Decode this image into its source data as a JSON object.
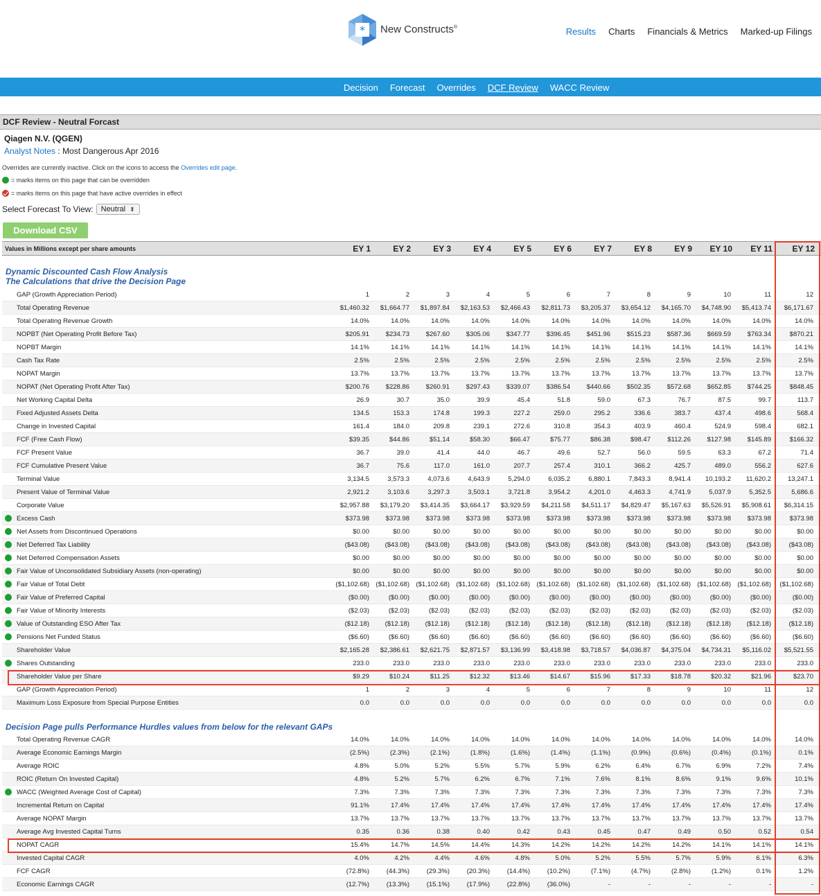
{
  "brand": {
    "name": "New Constructs",
    "mark": "®"
  },
  "topnav": [
    {
      "label": "Results",
      "active": true
    },
    {
      "label": "Charts",
      "active": false
    },
    {
      "label": "Financials & Metrics",
      "active": false
    },
    {
      "label": "Marked-up Filings",
      "active": false
    }
  ],
  "subnav": [
    {
      "label": "Decision",
      "active": false
    },
    {
      "label": "Forecast",
      "active": false
    },
    {
      "label": "Overrides",
      "active": false
    },
    {
      "label": "DCF Review",
      "active": true
    },
    {
      "label": "WACC Review",
      "active": false
    }
  ],
  "page_title": "DCF Review - Neutral Forcast",
  "company": "Qiagen N.V. (QGEN)",
  "analyst": {
    "link": "Analyst Notes",
    "sep": " : ",
    "text": "Most Dangerous Apr 2016"
  },
  "notes": {
    "overrides_pre": "Overrides are currently inactive. Click on the icons to access the ",
    "overrides_link": "Overrides edit page",
    "overrides_post": ".",
    "legend_green": "= marks items on this page that can be overridden",
    "legend_red": "= marks items on this page that have active overrides in effect"
  },
  "forecast_select": {
    "label": "Select Forecast To View:",
    "value": "Neutral",
    "arrows": "⬍"
  },
  "download_button": "Download CSV",
  "table": {
    "units_label": "Values in Millions except per share amounts",
    "columns": [
      "EY 1",
      "EY 2",
      "EY 3",
      "EY 4",
      "EY 5",
      "EY 6",
      "EY 7",
      "EY 8",
      "EY 9",
      "EY 10",
      "EY 11",
      "EY 12"
    ],
    "section1_line1": "Dynamic Discounted Cash Flow Analysis",
    "section1_line2": "The Calculations that drive the Decision Page",
    "section2": "Decision Page pulls Performance Hurdles values from below for the relevant GAPs",
    "rows1": [
      {
        "label": "GAP (Growth Appreciation Period)",
        "dot": false,
        "v": [
          "1",
          "2",
          "3",
          "4",
          "5",
          "6",
          "7",
          "8",
          "9",
          "10",
          "11",
          "12"
        ]
      },
      {
        "label": "Total Operating Revenue",
        "dot": false,
        "v": [
          "$1,460.32",
          "$1,664.77",
          "$1,897.84",
          "$2,163.53",
          "$2,466.43",
          "$2,811.73",
          "$3,205.37",
          "$3,654.12",
          "$4,165.70",
          "$4,748.90",
          "$5,413.74",
          "$6,171.67"
        ]
      },
      {
        "label": "Total Operating Revenue Growth",
        "dot": false,
        "v": [
          "14.0%",
          "14.0%",
          "14.0%",
          "14.0%",
          "14.0%",
          "14.0%",
          "14.0%",
          "14.0%",
          "14.0%",
          "14.0%",
          "14.0%",
          "14.0%"
        ]
      },
      {
        "label": "NOPBT (Net Operating Profit Before Tax)",
        "dot": false,
        "v": [
          "$205.91",
          "$234.73",
          "$267.60",
          "$305.06",
          "$347.77",
          "$396.45",
          "$451.96",
          "$515.23",
          "$587.36",
          "$669.59",
          "$763.34",
          "$870.21"
        ]
      },
      {
        "label": "NOPBT Margin",
        "dot": false,
        "v": [
          "14.1%",
          "14.1%",
          "14.1%",
          "14.1%",
          "14.1%",
          "14.1%",
          "14.1%",
          "14.1%",
          "14.1%",
          "14.1%",
          "14.1%",
          "14.1%"
        ]
      },
      {
        "label": "Cash Tax Rate",
        "dot": false,
        "v": [
          "2.5%",
          "2.5%",
          "2.5%",
          "2.5%",
          "2.5%",
          "2.5%",
          "2.5%",
          "2.5%",
          "2.5%",
          "2.5%",
          "2.5%",
          "2.5%"
        ]
      },
      {
        "label": "NOPAT Margin",
        "dot": false,
        "v": [
          "13.7%",
          "13.7%",
          "13.7%",
          "13.7%",
          "13.7%",
          "13.7%",
          "13.7%",
          "13.7%",
          "13.7%",
          "13.7%",
          "13.7%",
          "13.7%"
        ]
      },
      {
        "label": "NOPAT (Net Operating Profit After Tax)",
        "dot": false,
        "v": [
          "$200.76",
          "$228.86",
          "$260.91",
          "$297.43",
          "$339.07",
          "$386.54",
          "$440.66",
          "$502.35",
          "$572.68",
          "$652.85",
          "$744.25",
          "$848.45"
        ]
      },
      {
        "label": "Net Working Capital Delta",
        "dot": false,
        "v": [
          "26.9",
          "30.7",
          "35.0",
          "39.9",
          "45.4",
          "51.8",
          "59.0",
          "67.3",
          "76.7",
          "87.5",
          "99.7",
          "113.7"
        ]
      },
      {
        "label": "Fixed Adjusted Assets Delta",
        "dot": false,
        "v": [
          "134.5",
          "153.3",
          "174.8",
          "199.3",
          "227.2",
          "259.0",
          "295.2",
          "336.6",
          "383.7",
          "437.4",
          "498.6",
          "568.4"
        ]
      },
      {
        "label": "Change in Invested Capital",
        "dot": false,
        "v": [
          "161.4",
          "184.0",
          "209.8",
          "239.1",
          "272.6",
          "310.8",
          "354.3",
          "403.9",
          "460.4",
          "524.9",
          "598.4",
          "682.1"
        ]
      },
      {
        "label": "FCF (Free Cash Flow)",
        "dot": false,
        "v": [
          "$39.35",
          "$44.86",
          "$51.14",
          "$58.30",
          "$66.47",
          "$75.77",
          "$86.38",
          "$98.47",
          "$112.26",
          "$127.98",
          "$145.89",
          "$166.32"
        ]
      },
      {
        "label": "FCF Present Value",
        "dot": false,
        "v": [
          "36.7",
          "39.0",
          "41.4",
          "44.0",
          "46.7",
          "49.6",
          "52.7",
          "56.0",
          "59.5",
          "63.3",
          "67.2",
          "71.4"
        ]
      },
      {
        "label": "FCF Cumulative Present Value",
        "dot": false,
        "v": [
          "36.7",
          "75.6",
          "117.0",
          "161.0",
          "207.7",
          "257.4",
          "310.1",
          "366.2",
          "425.7",
          "489.0",
          "556.2",
          "627.6"
        ]
      },
      {
        "label": "Terminal Value",
        "dot": false,
        "v": [
          "3,134.5",
          "3,573.3",
          "4,073.6",
          "4,643.9",
          "5,294.0",
          "6,035.2",
          "6,880.1",
          "7,843.3",
          "8,941.4",
          "10,193.2",
          "11,620.2",
          "13,247.1"
        ]
      },
      {
        "label": "Present Value of Terminal Value",
        "dot": false,
        "v": [
          "2,921.2",
          "3,103.6",
          "3,297.3",
          "3,503.1",
          "3,721.8",
          "3,954.2",
          "4,201.0",
          "4,463.3",
          "4,741.9",
          "5,037.9",
          "5,352.5",
          "5,686.6"
        ]
      },
      {
        "label": "Corporate Value",
        "dot": false,
        "v": [
          "$2,957.88",
          "$3,179.20",
          "$3,414.35",
          "$3,664.17",
          "$3,929.59",
          "$4,211.58",
          "$4,511.17",
          "$4,829.47",
          "$5,167.63",
          "$5,526.91",
          "$5,908.61",
          "$6,314.15"
        ]
      },
      {
        "label": "Excess Cash",
        "dot": true,
        "v": [
          "$373.98",
          "$373.98",
          "$373.98",
          "$373.98",
          "$373.98",
          "$373.98",
          "$373.98",
          "$373.98",
          "$373.98",
          "$373.98",
          "$373.98",
          "$373.98"
        ]
      },
      {
        "label": "Net Assets from Discontinued Operations",
        "dot": true,
        "v": [
          "$0.00",
          "$0.00",
          "$0.00",
          "$0.00",
          "$0.00",
          "$0.00",
          "$0.00",
          "$0.00",
          "$0.00",
          "$0.00",
          "$0.00",
          "$0.00"
        ]
      },
      {
        "label": "Net Deferred Tax Liability",
        "dot": true,
        "v": [
          "($43.08)",
          "($43.08)",
          "($43.08)",
          "($43.08)",
          "($43.08)",
          "($43.08)",
          "($43.08)",
          "($43.08)",
          "($43.08)",
          "($43.08)",
          "($43.08)",
          "($43.08)"
        ]
      },
      {
        "label": "Net Deferred Compensation Assets",
        "dot": true,
        "v": [
          "$0.00",
          "$0.00",
          "$0.00",
          "$0.00",
          "$0.00",
          "$0.00",
          "$0.00",
          "$0.00",
          "$0.00",
          "$0.00",
          "$0.00",
          "$0.00"
        ]
      },
      {
        "label": "Fair Value of Unconsolidated Subsidiary Assets (non-operating)",
        "dot": true,
        "v": [
          "$0.00",
          "$0.00",
          "$0.00",
          "$0.00",
          "$0.00",
          "$0.00",
          "$0.00",
          "$0.00",
          "$0.00",
          "$0.00",
          "$0.00",
          "$0.00"
        ]
      },
      {
        "label": "Fair Value of Total Debt",
        "dot": true,
        "v": [
          "($1,102.68)",
          "($1,102.68)",
          "($1,102.68)",
          "($1,102.68)",
          "($1,102.68)",
          "($1,102.68)",
          "($1,102.68)",
          "($1,102.68)",
          "($1,102.68)",
          "($1,102.68)",
          "($1,102.68)",
          "($1,102.68)"
        ]
      },
      {
        "label": "Fair Value of Preferred Capital",
        "dot": true,
        "v": [
          "($0.00)",
          "($0.00)",
          "($0.00)",
          "($0.00)",
          "($0.00)",
          "($0.00)",
          "($0.00)",
          "($0.00)",
          "($0.00)",
          "($0.00)",
          "($0.00)",
          "($0.00)"
        ]
      },
      {
        "label": "Fair Value of Minority Interests",
        "dot": true,
        "v": [
          "($2.03)",
          "($2.03)",
          "($2.03)",
          "($2.03)",
          "($2.03)",
          "($2.03)",
          "($2.03)",
          "($2.03)",
          "($2.03)",
          "($2.03)",
          "($2.03)",
          "($2.03)"
        ]
      },
      {
        "label": "Value of Outstanding ESO After Tax",
        "dot": true,
        "v": [
          "($12.18)",
          "($12.18)",
          "($12.18)",
          "($12.18)",
          "($12.18)",
          "($12.18)",
          "($12.18)",
          "($12.18)",
          "($12.18)",
          "($12.18)",
          "($12.18)",
          "($12.18)"
        ]
      },
      {
        "label": "Pensions Net Funded Status",
        "dot": true,
        "v": [
          "($6.60)",
          "($6.60)",
          "($6.60)",
          "($6.60)",
          "($6.60)",
          "($6.60)",
          "($6.60)",
          "($6.60)",
          "($6.60)",
          "($6.60)",
          "($6.60)",
          "($6.60)"
        ]
      },
      {
        "label": "Shareholder Value",
        "dot": false,
        "v": [
          "$2,165.28",
          "$2,386.61",
          "$2,621.75",
          "$2,871.57",
          "$3,136.99",
          "$3,418.98",
          "$3,718.57",
          "$4,036.87",
          "$4,375.04",
          "$4,734.31",
          "$5,116.02",
          "$5,521.55"
        ]
      },
      {
        "label": "Shares Outstanding",
        "dot": true,
        "v": [
          "233.0",
          "233.0",
          "233.0",
          "233.0",
          "233.0",
          "233.0",
          "233.0",
          "233.0",
          "233.0",
          "233.0",
          "233.0",
          "233.0"
        ]
      },
      {
        "label": "Shareholder Value per Share",
        "dot": false,
        "v": [
          "$9.29",
          "$10.24",
          "$11.25",
          "$12.32",
          "$13.46",
          "$14.67",
          "$15.96",
          "$17.33",
          "$18.78",
          "$20.32",
          "$21.96",
          "$23.70"
        ]
      },
      {
        "label": "GAP (Growth Appreciation Period)",
        "dot": false,
        "v": [
          "1",
          "2",
          "3",
          "4",
          "5",
          "6",
          "7",
          "8",
          "9",
          "10",
          "11",
          "12"
        ]
      },
      {
        "label": "Maximum Loss Exposure from Special Purpose Entities",
        "dot": false,
        "v": [
          "0.0",
          "0.0",
          "0.0",
          "0.0",
          "0.0",
          "0.0",
          "0.0",
          "0.0",
          "0.0",
          "0.0",
          "0.0",
          "0.0"
        ]
      }
    ],
    "rows2": [
      {
        "label": "Total Operating Revenue CAGR",
        "dot": false,
        "v": [
          "14.0%",
          "14.0%",
          "14.0%",
          "14.0%",
          "14.0%",
          "14.0%",
          "14.0%",
          "14.0%",
          "14.0%",
          "14.0%",
          "14.0%",
          "14.0%"
        ]
      },
      {
        "label": "Average Economic Earnings Margin",
        "dot": false,
        "v": [
          "(2.5%)",
          "(2.3%)",
          "(2.1%)",
          "(1.8%)",
          "(1.6%)",
          "(1.4%)",
          "(1.1%)",
          "(0.9%)",
          "(0.6%)",
          "(0.4%)",
          "(0.1%)",
          "0.1%"
        ]
      },
      {
        "label": "Average ROIC",
        "dot": false,
        "v": [
          "4.8%",
          "5.0%",
          "5.2%",
          "5.5%",
          "5.7%",
          "5.9%",
          "6.2%",
          "6.4%",
          "6.7%",
          "6.9%",
          "7.2%",
          "7.4%"
        ]
      },
      {
        "label": "ROIC (Return On Invested Capital)",
        "dot": false,
        "v": [
          "4.8%",
          "5.2%",
          "5.7%",
          "6.2%",
          "6.7%",
          "7.1%",
          "7.6%",
          "8.1%",
          "8.6%",
          "9.1%",
          "9.6%",
          "10.1%"
        ]
      },
      {
        "label": "WACC (Weighted Average Cost of Capital)",
        "dot": true,
        "v": [
          "7.3%",
          "7.3%",
          "7.3%",
          "7.3%",
          "7.3%",
          "7.3%",
          "7.3%",
          "7.3%",
          "7.3%",
          "7.3%",
          "7.3%",
          "7.3%"
        ]
      },
      {
        "label": "Incremental Return on Capital",
        "dot": false,
        "v": [
          "91.1%",
          "17.4%",
          "17.4%",
          "17.4%",
          "17.4%",
          "17.4%",
          "17.4%",
          "17.4%",
          "17.4%",
          "17.4%",
          "17.4%",
          "17.4%"
        ]
      },
      {
        "label": "Average NOPAT Margin",
        "dot": false,
        "v": [
          "13.7%",
          "13.7%",
          "13.7%",
          "13.7%",
          "13.7%",
          "13.7%",
          "13.7%",
          "13.7%",
          "13.7%",
          "13.7%",
          "13.7%",
          "13.7%"
        ]
      },
      {
        "label": "Average Avg Invested Capital Turns",
        "dot": false,
        "v": [
          "0.35",
          "0.36",
          "0.38",
          "0.40",
          "0.42",
          "0.43",
          "0.45",
          "0.47",
          "0.49",
          "0.50",
          "0.52",
          "0.54"
        ]
      },
      {
        "label": "NOPAT CAGR",
        "dot": false,
        "v": [
          "15.4%",
          "14.7%",
          "14.5%",
          "14.4%",
          "14.3%",
          "14.2%",
          "14.2%",
          "14.2%",
          "14.2%",
          "14.1%",
          "14.1%",
          "14.1%"
        ]
      },
      {
        "label": "Invested Capital CAGR",
        "dot": false,
        "v": [
          "4.0%",
          "4.2%",
          "4.4%",
          "4.6%",
          "4.8%",
          "5.0%",
          "5.2%",
          "5.5%",
          "5.7%",
          "5.9%",
          "6.1%",
          "6.3%"
        ]
      },
      {
        "label": "FCF CAGR",
        "dot": false,
        "v": [
          "(72.8%)",
          "(44.3%)",
          "(29.3%)",
          "(20.3%)",
          "(14.4%)",
          "(10.2%)",
          "(7.1%)",
          "(4.7%)",
          "(2.8%)",
          "(1.2%)",
          "0.1%",
          "1.2%"
        ]
      },
      {
        "label": "Economic Earnings CAGR",
        "dot": false,
        "v": [
          "(12.7%)",
          "(13.3%)",
          "(15.1%)",
          "(17.9%)",
          "(22.8%)",
          "(36.0%)",
          "-",
          "-",
          "-",
          "-",
          "-",
          "-"
        ]
      }
    ]
  },
  "colors": {
    "accent": "#2196d9",
    "highlight": "#e53e2a",
    "override_dot": "#1aa032",
    "section_title": "#2a5ea8"
  }
}
